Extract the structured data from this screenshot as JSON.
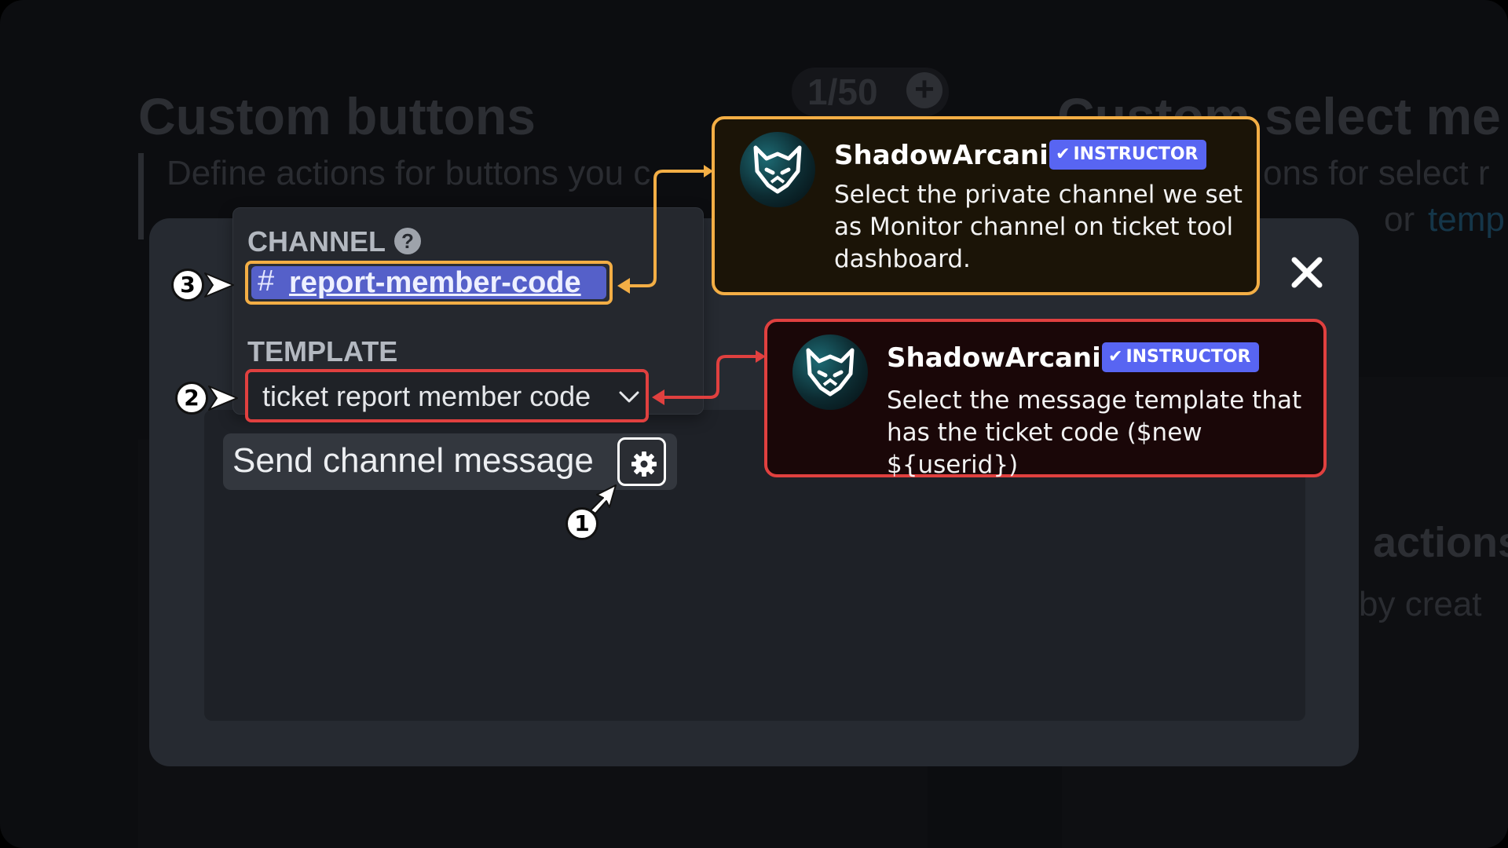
{
  "background": {
    "title_left": "Custom buttons",
    "subtitle_left": "Define actions for buttons you c",
    "counter": "1/50",
    "title_right": "Custom select me",
    "subtitle_right": "ons for select r",
    "link_right_or": "or",
    "link_right": "temp",
    "section_right": "actions",
    "section_right_sub": "by creat"
  },
  "form": {
    "channel_label": "CHANNEL",
    "channel_value": "report-member-code",
    "channel_prefix": "#",
    "template_label": "TEMPLATE",
    "template_value": "ticket report member code",
    "action_label": "Send channel message"
  },
  "steps": [
    "1",
    "2",
    "3"
  ],
  "callouts": [
    {
      "author": "ShadowArcanist",
      "badge": "INSTRUCTOR",
      "text": "Select the private channel we set as Monitor channel on ticket tool dashboard.",
      "color": "#f3ae45"
    },
    {
      "author": "ShadowArcanist",
      "badge": "INSTRUCTOR",
      "text": "Select the message template that has the ticket code ($new ${userid})",
      "color": "#e0403f"
    }
  ],
  "icons": {
    "close": "close-icon",
    "help": "help-icon",
    "gear": "gear-icon",
    "chevron": "chevron-down-icon",
    "check": "check-icon",
    "help_glyph": "?",
    "check_glyph": "✔"
  }
}
